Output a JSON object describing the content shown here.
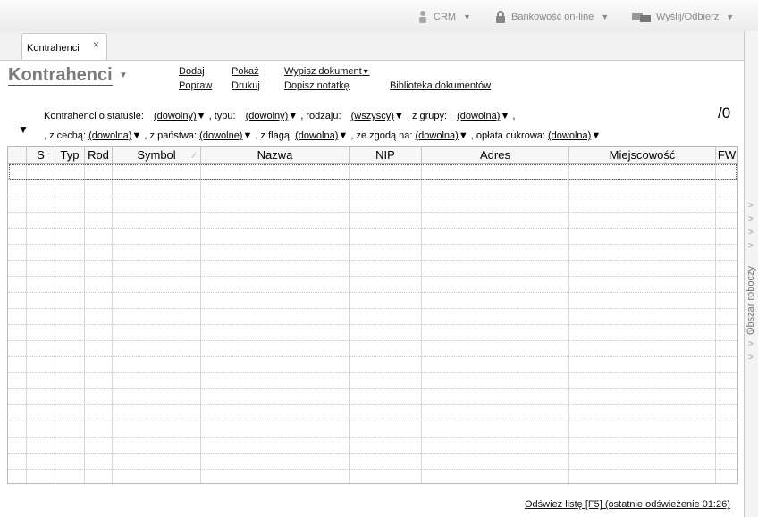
{
  "toolbar": {
    "crm_label": "CRM",
    "bank_label": "Bankowość on-line",
    "send_label": "Wyślij/Odbierz"
  },
  "tab": {
    "label": "Kontrahenci",
    "close": "×"
  },
  "page_title": "Kontrahenci",
  "actions": {
    "add": "Dodaj",
    "edit": "Popraw",
    "show": "Pokaż",
    "print": "Drukuj",
    "issue_document": "Wypisz dokument",
    "add_note": "Dopisz notatkę",
    "document_library": "Biblioteka dokumentów"
  },
  "count": "/0",
  "filters": {
    "status_label": "Kontrahenci o statusie:",
    "status_value": "(dowolny)",
    "type_label": ", typu:",
    "type_value": "(dowolny)",
    "kind_label": ", rodzaju:",
    "kind_value": "(wszyscy)",
    "group_label": ", z grupy:",
    "group_value": "(dowolna)",
    "group_tail": ",",
    "feature_label": ", z cechą:",
    "feature_value": "(dowolna)",
    "country_label": ", z państwa:",
    "country_value": "(dowolne)",
    "flag_label": ", z flagą:",
    "flag_value": "(dowolna)",
    "consent_label": ", ze zgodą na:",
    "consent_value": "(dowolna)",
    "sugar_label": ", opłata cukrowa:",
    "sugar_value": "(dowolna)"
  },
  "table": {
    "columns": [
      "",
      "S",
      "Typ",
      "Rod",
      "Symbol",
      "Nazwa",
      "NIP",
      "Adres",
      "Miejscowość",
      "FW"
    ],
    "rows": []
  },
  "side_panel_label": "Obszar roboczy",
  "refresh_label": "Odśwież listę [F5] (ostatnie odświeżenie 01:26)"
}
